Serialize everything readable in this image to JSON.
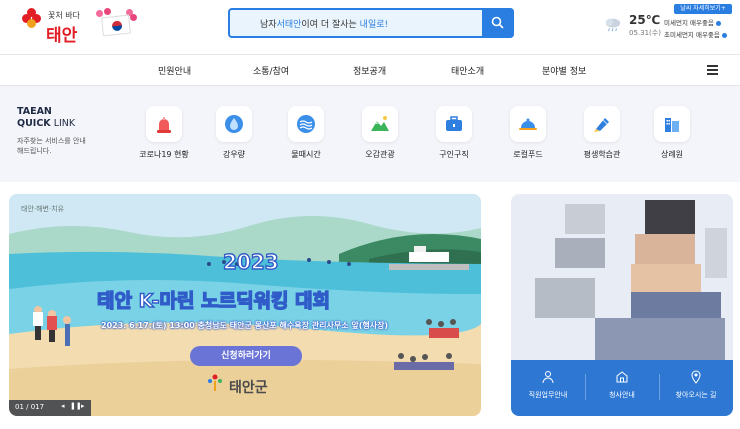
{
  "header": {
    "logo_tagline": "꽃처 바다",
    "logo_name": "태안",
    "search": {
      "text_pre": "남자",
      "text_highlight1": "서태안",
      "text_mid": "이여 더 잘사는 ",
      "text_highlight2": "내일로!"
    },
    "weather": {
      "temperature": "25℃",
      "date": "05.31(수)",
      "detail_button": "날씨 자세히보기+",
      "fine_dust": "미세먼지 매우좋음",
      "ultrafine_dust": "초미세먼지 매우좋음"
    }
  },
  "nav": {
    "items": [
      "민원안내",
      "소통/참여",
      "정보공개",
      "태안소개",
      "분야별 정보"
    ]
  },
  "quick": {
    "title_line1": "TAEAN",
    "title_line2_bold": "QUICK",
    "title_line2_light": " LINK",
    "desc": "자주찾는 서비스를 안내해드립니다.",
    "links": [
      {
        "label": "코로나19 현황",
        "icon": "siren-icon"
      },
      {
        "label": "강우량",
        "icon": "raindrop-icon"
      },
      {
        "label": "물때시간",
        "icon": "wave-icon"
      },
      {
        "label": "오감관광",
        "icon": "mountain-icon"
      },
      {
        "label": "구인구직",
        "icon": "briefcase-icon"
      },
      {
        "label": "로컬푸드",
        "icon": "food-cloche-icon"
      },
      {
        "label": "평생학습관",
        "icon": "pen-icon"
      },
      {
        "label": "상례원",
        "icon": "building-icon"
      }
    ]
  },
  "banner": {
    "brand": "태안·해변·치유",
    "year": "2023",
    "title_part1": "태안 K-",
    "title_part2": "마린",
    "title_part3": " 노르딕워킹 대회",
    "subtitle": "2023. 6.17.(토) 13:00  충청남도 태안군 몽산포 해수욕장 관리사무소 앞(행사장)",
    "cta": "신청하러가기",
    "org_logo": "태안군",
    "pager": "01 / 017"
  },
  "mayor_panel": {
    "items": [
      {
        "label": "직원업무안내",
        "icon": "people-icon"
      },
      {
        "label": "청사안내",
        "icon": "building-outline-icon"
      },
      {
        "label": "찾아오시는 길",
        "icon": "map-pin-icon"
      }
    ]
  },
  "colors": {
    "accent": "#2a7de1",
    "brand_red": "#e31f26",
    "mayor_bar": "#2e78d4",
    "cta": "#6a73d6"
  }
}
